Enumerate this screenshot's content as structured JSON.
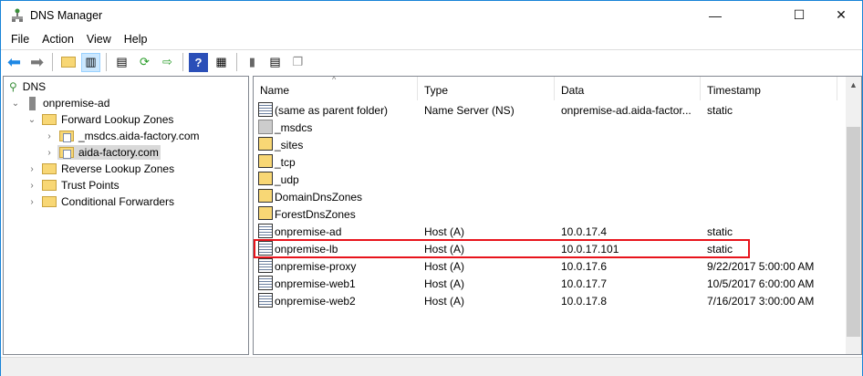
{
  "window": {
    "title": "DNS Manager",
    "minimize": "—",
    "maximize": "☐",
    "close": "✕"
  },
  "menu": [
    {
      "label": "File"
    },
    {
      "label": "Action"
    },
    {
      "label": "View"
    },
    {
      "label": "Help"
    }
  ],
  "toolbar": {
    "help": "?"
  },
  "tree": {
    "root": "DNS",
    "server": "onpremise-ad",
    "forward": "Forward Lookup Zones",
    "zones": [
      "_msdcs.aida-factory.com",
      "aida-factory.com"
    ],
    "others": [
      "Reverse Lookup Zones",
      "Trust Points",
      "Conditional Forwarders"
    ]
  },
  "list": {
    "columns": [
      "Name",
      "Type",
      "Data",
      "Timestamp"
    ],
    "rows": [
      {
        "name": "(same as parent folder)",
        "type": "Name Server (NS)",
        "data": "onpremise-ad.aida-factor...",
        "ts": "static",
        "icon": "record"
      },
      {
        "name": "_msdcs",
        "type": "",
        "data": "",
        "ts": "",
        "icon": "delegation"
      },
      {
        "name": "_sites",
        "type": "",
        "data": "",
        "ts": "",
        "icon": "folder"
      },
      {
        "name": "_tcp",
        "type": "",
        "data": "",
        "ts": "",
        "icon": "folder"
      },
      {
        "name": "_udp",
        "type": "",
        "data": "",
        "ts": "",
        "icon": "folder"
      },
      {
        "name": "DomainDnsZones",
        "type": "",
        "data": "",
        "ts": "",
        "icon": "folder"
      },
      {
        "name": "ForestDnsZones",
        "type": "",
        "data": "",
        "ts": "",
        "icon": "folder"
      },
      {
        "name": "onpremise-ad",
        "type": "Host (A)",
        "data": "10.0.17.4",
        "ts": "static",
        "icon": "record"
      },
      {
        "name": "onpremise-lb",
        "type": "Host (A)",
        "data": "10.0.17.101",
        "ts": "static",
        "icon": "record"
      },
      {
        "name": "onpremise-proxy",
        "type": "Host (A)",
        "data": "10.0.17.6",
        "ts": "9/22/2017 5:00:00 AM",
        "icon": "record"
      },
      {
        "name": "onpremise-web1",
        "type": "Host (A)",
        "data": "10.0.17.7",
        "ts": "10/5/2017 6:00:00 AM",
        "icon": "record"
      },
      {
        "name": "onpremise-web2",
        "type": "Host (A)",
        "data": "10.0.17.8",
        "ts": "7/16/2017 3:00:00 AM",
        "icon": "record"
      }
    ],
    "highlight_color": "#e8141c"
  }
}
